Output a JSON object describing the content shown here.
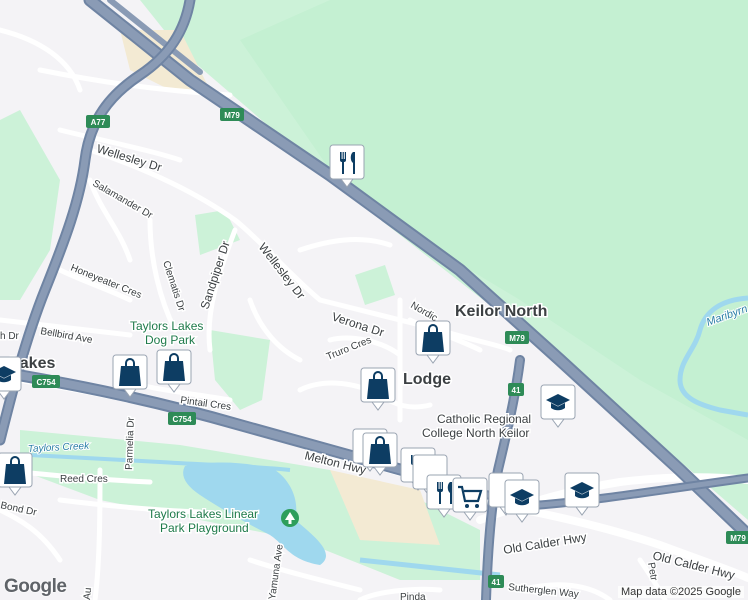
{
  "map": {
    "labels": {
      "keilor_north": "Keilor North",
      "lakes_partial": "Lakes",
      "lodge_partial": "Lodge",
      "wellesley_dr_top": "Wellesley Dr",
      "wellesley_dr_mid": "Wellesley Dr",
      "salamander_dr": "Salamander Dr",
      "clematis_dr": "Clematis Dr",
      "sandpiper_dr": "Sandpiper Dr",
      "honeyeater_cres": "Honeyeater Cres",
      "bellbird_ave": "Bellbird Ave",
      "verona_dr": "Verona Dr",
      "truro_cres": "Truro Cres",
      "nordic_partial": "Nordic",
      "pintail_cres": "Pintail Cres",
      "parmelia_dr": "Parmelia Dr",
      "reed_cres": "Reed Cres",
      "bond_partial": "Bond Dr",
      "melton_hwy": "Melton Hwy",
      "old_calder_hwy_mid": "Old Calder Hwy",
      "old_calder_hwy_right": "Old Calder Hwy",
      "sutherglen_way": "Sutherglen Way",
      "pinda_partial": "Pinda",
      "au_partial": "Au",
      "dr_partial": "h Dr",
      "yamuna_partial": "Yamuna Ave",
      "petr_partial": "Petr",
      "maribyrnong_partial": "Maribyrn",
      "taylors_creek": "Taylors Creek"
    },
    "parks": {
      "dog_park": [
        "Taylors Lakes",
        "Dog Park"
      ],
      "linear_park": [
        "Taylors Lakes Linear",
        "Park Playground"
      ]
    },
    "school": [
      "Catholic Regional",
      "College North Keilor"
    ],
    "shields": {
      "m79_top": "M79",
      "m79_right": "M79",
      "a77": "A77",
      "c754_left": "C754",
      "c754_mid": "C754",
      "r41_mid": "41",
      "r41_bottom": "41",
      "m79_edge": "M79"
    },
    "attribution": "Map data ©2025 Google",
    "logo": "Google"
  },
  "colors": {
    "land": "#f4f3f6",
    "park": "#ccf2d8",
    "park_dark": "#b9ebc8",
    "freeway": "#8a9bb5",
    "freeway_edge": "#6f84a3",
    "water": "#9fd8ee",
    "marker_fill": "#0d3d63",
    "marker_bg": "#ffffff"
  },
  "markers": [
    {
      "icon": "restaurant-icon"
    },
    {
      "icon": "shopping-bag-icon"
    },
    {
      "icon": "shopping-bag-icon"
    },
    {
      "icon": "shopping-bag-icon"
    },
    {
      "icon": "shopping-bag-icon"
    },
    {
      "icon": "shopping-bag-icon"
    },
    {
      "icon": "shopping-bag-icon"
    },
    {
      "icon": "school-icon"
    },
    {
      "icon": "school-icon"
    },
    {
      "icon": "school-icon"
    },
    {
      "icon": "school-icon"
    },
    {
      "icon": "restaurant-icon"
    },
    {
      "icon": "restaurant-icon"
    },
    {
      "icon": "shopping-cart-icon"
    }
  ]
}
